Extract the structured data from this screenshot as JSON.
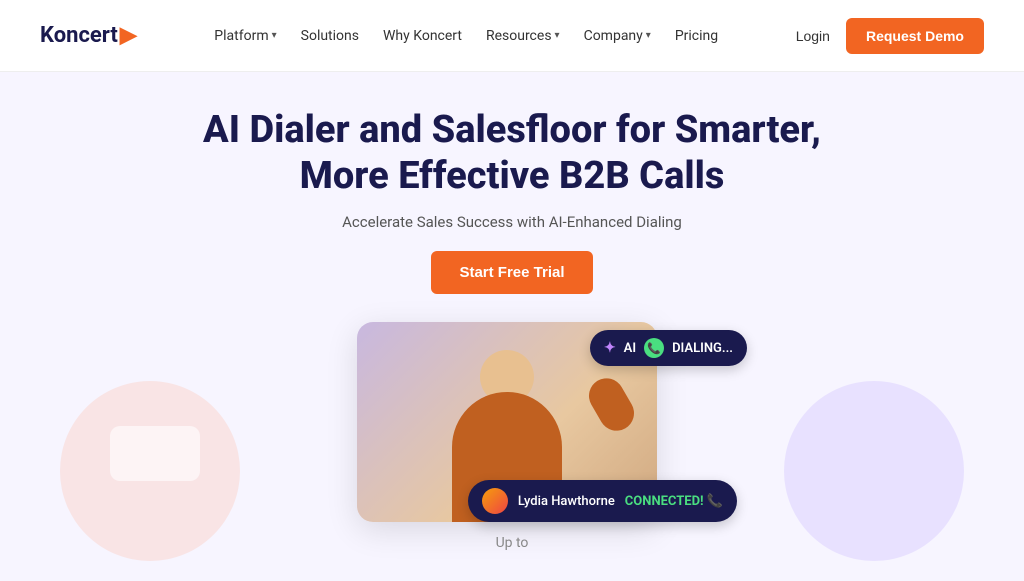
{
  "logo": {
    "text": "Koncert",
    "arrow": "▶"
  },
  "nav": {
    "links": [
      {
        "label": "Platform",
        "has_dropdown": true
      },
      {
        "label": "Solutions",
        "has_dropdown": false
      },
      {
        "label": "Why Koncert",
        "has_dropdown": false
      },
      {
        "label": "Resources",
        "has_dropdown": true
      },
      {
        "label": "Company",
        "has_dropdown": true
      },
      {
        "label": "Pricing",
        "has_dropdown": false
      }
    ],
    "login": "Login",
    "demo": "Request Demo"
  },
  "hero": {
    "title_line1": "AI Dialer and Salesfloor for Smarter,",
    "title_line2": "More Effective B2B Calls",
    "subtitle": "Accelerate Sales Success with AI-Enhanced Dialing",
    "cta": "Start Free Trial"
  },
  "badge_dialing": {
    "ai_label": "✦ AI",
    "phone_icon": "📞",
    "text": "DIALING..."
  },
  "badge_connected": {
    "name": "Lydia Hawthorne",
    "status": "CONNECTED! 📞"
  },
  "bottom": {
    "label": "Up to"
  }
}
